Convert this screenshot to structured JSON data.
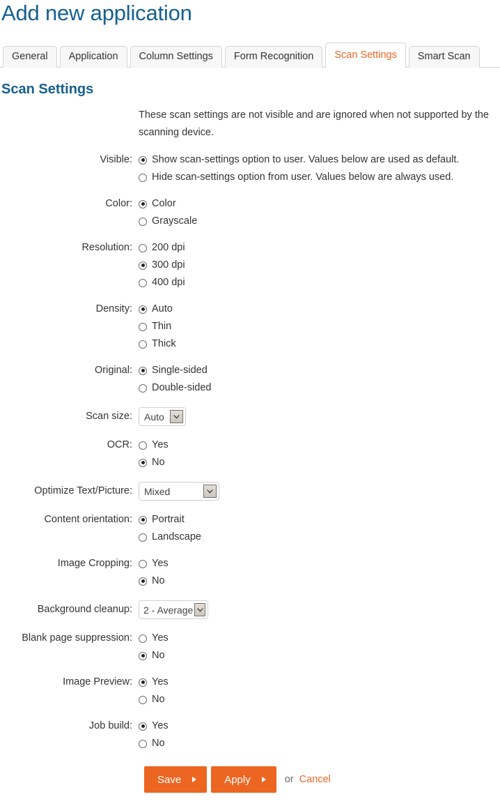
{
  "page": {
    "title": "Add new application",
    "section_heading": "Scan Settings",
    "accent_color": "#ec6622",
    "heading_color": "#15608f"
  },
  "tabs": [
    {
      "label": "General",
      "active": false
    },
    {
      "label": "Application",
      "active": false
    },
    {
      "label": "Column Settings",
      "active": false
    },
    {
      "label": "Form Recognition",
      "active": false
    },
    {
      "label": "Scan Settings",
      "active": true
    },
    {
      "label": "Smart Scan",
      "active": false
    }
  ],
  "intro": "These scan settings are not visible and are ignored when not supported by the scanning device.",
  "fields": {
    "visible": {
      "label": "Visible:",
      "options": [
        {
          "label": "Show scan-settings option to user. Values below are used as default.",
          "checked": true
        },
        {
          "label": "Hide scan-settings option from user. Values below are always used.",
          "checked": false
        }
      ]
    },
    "color": {
      "label": "Color:",
      "options": [
        {
          "label": "Color",
          "checked": true
        },
        {
          "label": "Grayscale",
          "checked": false
        }
      ]
    },
    "resolution": {
      "label": "Resolution:",
      "options": [
        {
          "label": "200 dpi",
          "checked": false
        },
        {
          "label": "300 dpi",
          "checked": true
        },
        {
          "label": "400 dpi",
          "checked": false
        }
      ]
    },
    "density": {
      "label": "Density:",
      "options": [
        {
          "label": "Auto",
          "checked": true
        },
        {
          "label": "Thin",
          "checked": false
        },
        {
          "label": "Thick",
          "checked": false
        }
      ]
    },
    "original": {
      "label": "Original:",
      "options": [
        {
          "label": "Single-sided",
          "checked": true
        },
        {
          "label": "Double-sided",
          "checked": false
        }
      ]
    },
    "scan_size": {
      "label": "Scan size:",
      "value": "Auto"
    },
    "ocr": {
      "label": "OCR:",
      "options": [
        {
          "label": "Yes",
          "checked": false
        },
        {
          "label": "No",
          "checked": true
        }
      ]
    },
    "optimize": {
      "label": "Optimize Text/Picture:",
      "value": "Mixed"
    },
    "content_orientation": {
      "label": "Content orientation:",
      "options": [
        {
          "label": "Portrait",
          "checked": true
        },
        {
          "label": "Landscape",
          "checked": false
        }
      ]
    },
    "image_cropping": {
      "label": "Image Cropping:",
      "options": [
        {
          "label": "Yes",
          "checked": false
        },
        {
          "label": "No",
          "checked": true
        }
      ]
    },
    "background_cleanup": {
      "label": "Background cleanup:",
      "value": "2 - Average"
    },
    "blank_page_suppression": {
      "label": "Blank page suppression:",
      "options": [
        {
          "label": "Yes",
          "checked": false
        },
        {
          "label": "No",
          "checked": true
        }
      ]
    },
    "image_preview": {
      "label": "Image Preview:",
      "options": [
        {
          "label": "Yes",
          "checked": true
        },
        {
          "label": "No",
          "checked": false
        }
      ]
    },
    "job_build": {
      "label": "Job build:",
      "options": [
        {
          "label": "Yes",
          "checked": true
        },
        {
          "label": "No",
          "checked": false
        }
      ]
    }
  },
  "actions": {
    "save_label": "Save",
    "apply_label": "Apply",
    "or_label": "or",
    "cancel_label": "Cancel"
  }
}
